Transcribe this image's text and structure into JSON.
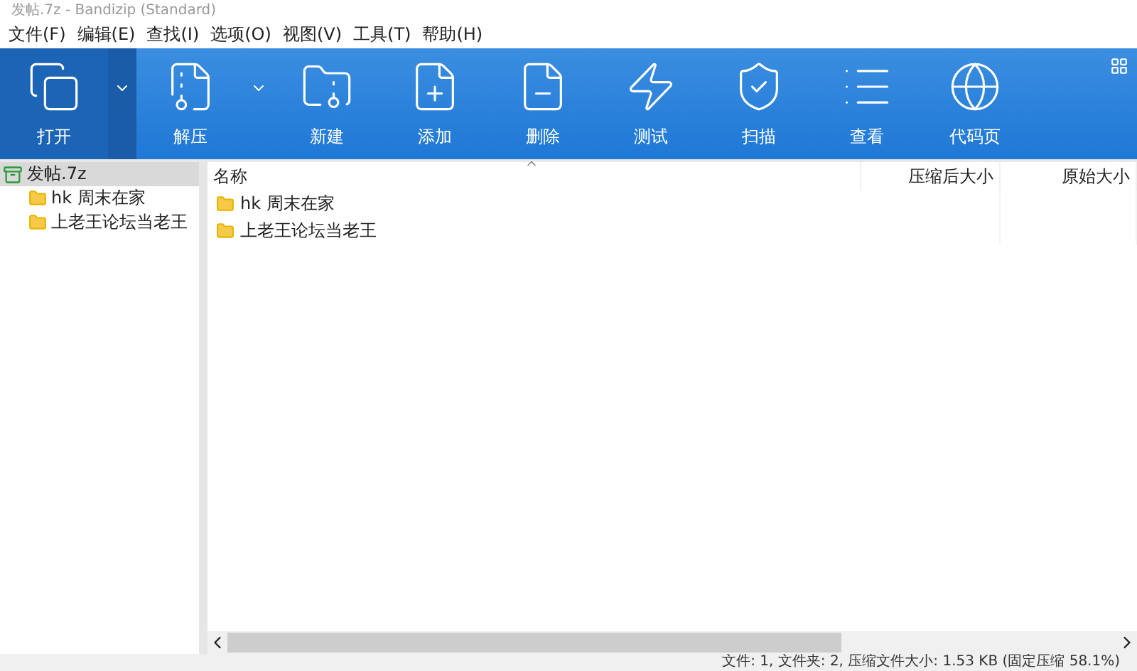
{
  "window": {
    "title": "发帖.7z - Bandizip (Standard)"
  },
  "menu": [
    "文件(F)",
    "编辑(E)",
    "查找(I)",
    "选项(O)",
    "视图(V)",
    "工具(T)",
    "帮助(H)"
  ],
  "toolbar": [
    {
      "kind": "open",
      "label": "打开",
      "dropdown": true
    },
    {
      "kind": "extract",
      "label": "解压",
      "dropdown": true
    },
    {
      "kind": "new",
      "label": "新建"
    },
    {
      "kind": "add",
      "label": "添加"
    },
    {
      "kind": "delete",
      "label": "删除"
    },
    {
      "kind": "test",
      "label": "测试"
    },
    {
      "kind": "scan",
      "label": "扫描"
    },
    {
      "kind": "view",
      "label": "查看"
    },
    {
      "kind": "codepage",
      "label": "代码页"
    }
  ],
  "tree": {
    "label": "发帖.7z",
    "selected": true,
    "children": [
      {
        "label": "hk 周末在家",
        "selected": false
      },
      {
        "label": "上老王论坛当老王",
        "selected": false
      }
    ]
  },
  "table": {
    "columns": [
      "名称",
      "压缩后大小",
      "原始大小"
    ],
    "rows": [
      {
        "name": "hk 周末在家"
      },
      {
        "name": "上老王论坛当老王"
      }
    ]
  },
  "status_bar": {
    "text": "文件: 1, 文件夹: 2, 压缩文件大小: 1.53 KB (固定压缩 58.1%)"
  }
}
